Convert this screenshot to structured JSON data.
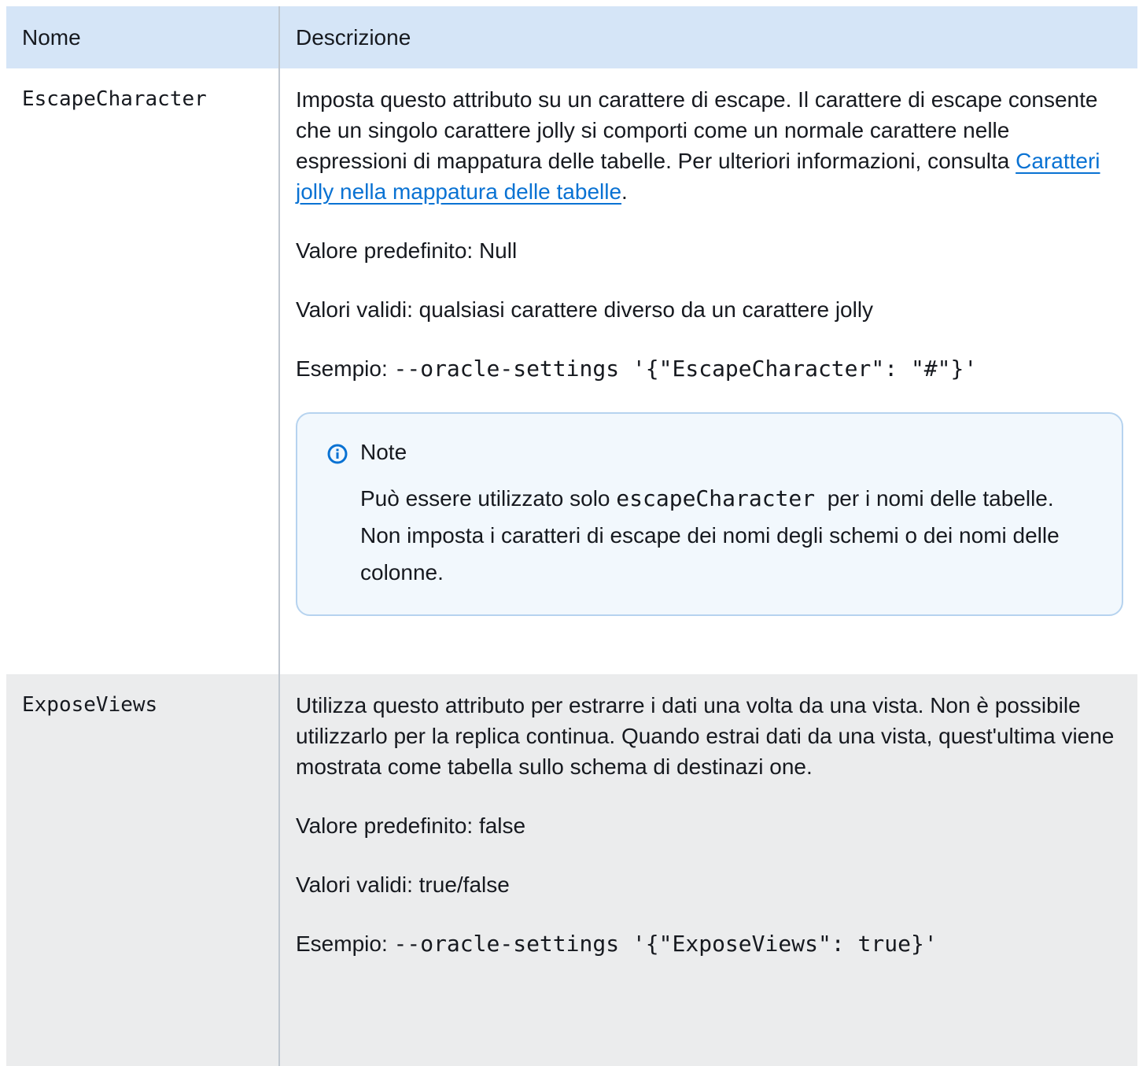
{
  "table": {
    "headers": {
      "name": "Nome",
      "description": "Descrizione"
    },
    "rows": [
      {
        "name": "EscapeCharacter",
        "description_prefix": "Imposta questo attributo su un carattere di escape. Il carattere di escape consente che un singolo carattere jolly si comporti come un normale carattere nelle espressioni di mappatura delle tabelle. Per ulteriori informazioni, consulta ",
        "link_text": "Caratteri jolly nella mappatura delle tabelle",
        "description_suffix": ".",
        "default_value": "Valore predefinito: Null",
        "valid_values": "Valori validi: qualsiasi carattere diverso da un carattere jolly",
        "example_label": "Esempio: ",
        "example_code": "--oracle-settings '{\"EscapeCharacter\": \"#\"}'",
        "note": {
          "icon": "info-icon",
          "title": "Note",
          "text_before": "Può essere utilizzato solo ",
          "code": "escapeCharacter",
          "text_after": "  per i nomi delle tabelle. Non imposta i caratteri di escape dei nomi degli schemi o dei nomi delle colonne."
        }
      },
      {
        "name": "ExposeViews",
        "description": "Utilizza questo attributo per estrarre i dati una volta da una vista. Non è possibile utilizzarlo per la replica continua. Quando estrai dati da una vista, quest'ultima viene mostrata come tabella sullo schema di destinazi one.",
        "default_value": "Valore predefinito: false",
        "valid_values": "Valori validi: true/false",
        "example_label": "Esempio: ",
        "example_code": "--oracle-settings '{\"ExposeViews\": true}'"
      }
    ]
  },
  "colors": {
    "header_bg": "#d5e5f7",
    "row_alt_bg": "#ebeced",
    "link": "#0972d3",
    "note_bg": "#f2f8fd",
    "note_border": "#b6d3ef",
    "text": "#16191f"
  }
}
